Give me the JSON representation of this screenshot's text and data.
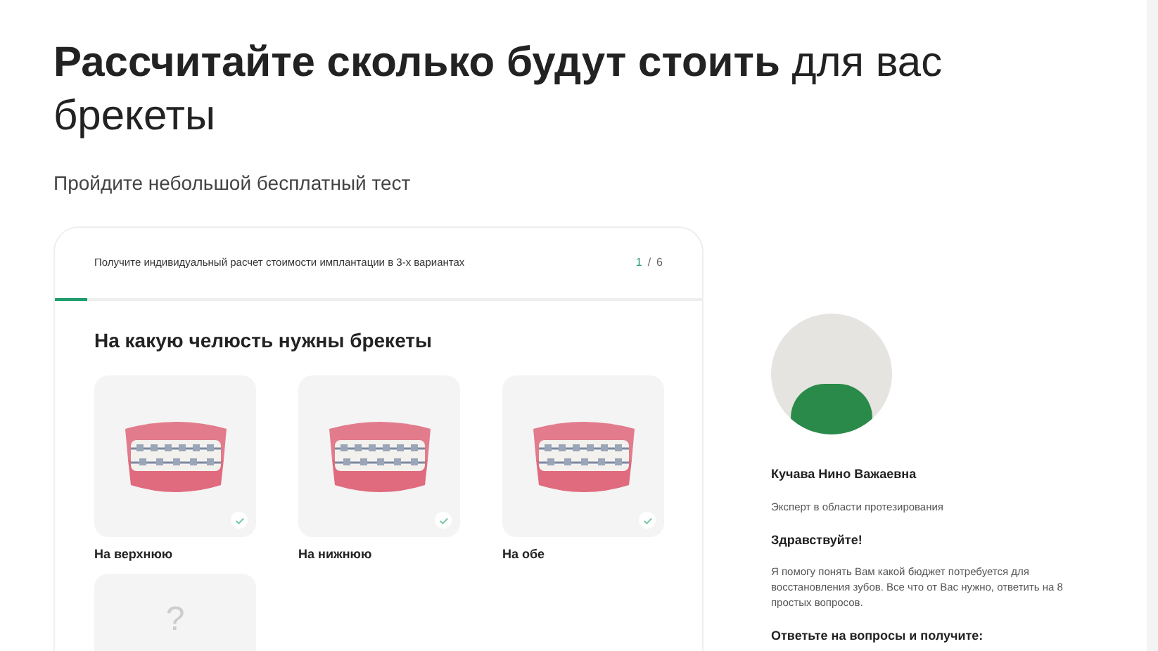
{
  "heading": {
    "text": "**Рассчитайте сколько будут стоить** для вас брекеты"
  },
  "subtitle": "Пройдите небольшой бесплатный тест",
  "quiz": {
    "header": "Получите индивидуальный расчет стоимости имплантации в 3-х вариантах",
    "step_current": "1",
    "step_separator": "/",
    "step_total": "6",
    "level": 0.05,
    "question": "На какую челюсть нужны брекеты",
    "options": [
      {
        "kind": "image",
        "label": "На верхнюю",
        "selected": false
      },
      {
        "kind": "image",
        "label": "На нижнюю",
        "selected": false
      },
      {
        "kind": "image",
        "label": "На обе",
        "selected": false
      },
      {
        "kind": "unknown",
        "symbol": "?",
        "selected": false
      }
    ]
  },
  "expert": {
    "name": "Кучава Нино Важаевна",
    "role": "Эксперт в области протезирования",
    "greeting": "Здравствуйте!",
    "message": "Я помогу понять Вам какой бюджет потребуется для восстановления зубов. Все что от Вас нужно, ответить на 8 простых вопросов.",
    "cta": "Ответьте на вопросы и получите:"
  }
}
